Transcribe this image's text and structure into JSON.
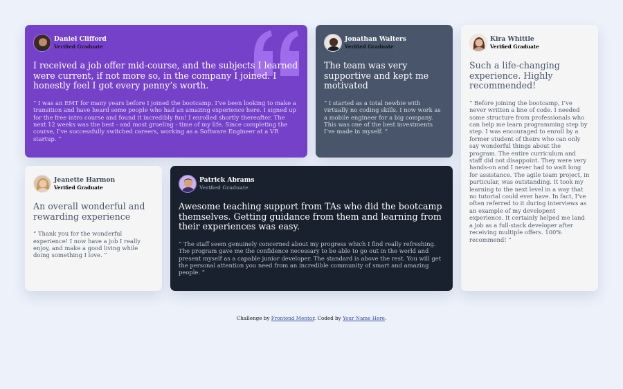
{
  "testimonials": [
    {
      "name": "Daniel Clifford",
      "role": "Verified Graduate",
      "headline": "I received a job offer mid-course, and the subjects I learned were current, if not more so, in the company I joined. I honestly feel I got every penny’s worth.",
      "body": "“ I was an EMT for many years before I joined the bootcamp. I’ve been looking to make a transition and have heard some people who had an amazing experience here. I signed up for the free intro course and found it incredibly fun! I enrolled shortly thereafter. The next 12 weeks was the best - and most grueling - time of my life. Since completing the course, I’ve successfully switched careers, working as a Software Engineer at a VR startup. ”"
    },
    {
      "name": "Jonathan Walters",
      "role": "Verified Graduate",
      "headline": "The team was very supportive and kept me motivated",
      "body": "“ I started as a total newbie with virtually no coding skills. I now work as a mobile engineer for a big company. This was one of the best investments I’ve made in myself. ”"
    },
    {
      "name": "Kira Whittle",
      "role": "Verified Graduate",
      "headline": "Such a life-changing experience. Highly recommended!",
      "body": "“ Before joining the bootcamp, I’ve never written a line of code. I needed some structure from professionals who can help me learn programming step by step. I was encouraged to enroll by a former student of theirs who can only say wonderful things about the program. The entire curriculum and staff did not disappoint. They were very hands-on and I never had to wait long for assistance. The agile team project, in particular, was outstanding. It took my learning to the next level in a way that no tutorial could ever have. In fact, I’ve often referred to it during interviews as an example of my developent experience. It certainly helped me land a job as a full-stack developer after receiving multiple offers. 100% recommend! ”"
    },
    {
      "name": "Jeanette Harmon",
      "role": "Verified Graduate",
      "headline": "An overall wonderful and rewarding experience",
      "body": "“ Thank you for the wonderful experience! I now have a job I really enjoy, and make a good living while doing something I love. ”"
    },
    {
      "name": "Patrick Abrams",
      "role": "Verified Graduate",
      "headline": "Awesome teaching support from TAs who did the bootcamp themselves. Getting guidance from them and learning from their experiences was easy.",
      "body": "“ The staff seem genuinely concerned about my progress which I find really refreshing. The program gave me the confidence necessary to be able to go out in the world and present myself as a capable junior developer. The standard is above the rest. You will get the personal attention you need from an incredible community of smart and amazing people. ”"
    }
  ],
  "footer": {
    "prefix": "Challenge by ",
    "link1": "Frontend Mentor",
    "middle": ". Coded by ",
    "link2": "Your Name Here",
    "suffix": "."
  },
  "colors": {
    "background": "#ecf1fa",
    "violet": "#7541c8",
    "grayish_blue": "#48556a",
    "light_gray": "#f5f5f5",
    "blackish_blue": "#19212e",
    "quote_mark": "#a775f1"
  },
  "icons": {
    "quote": "quotation-mark-icon",
    "avatar": "avatar-photo"
  }
}
